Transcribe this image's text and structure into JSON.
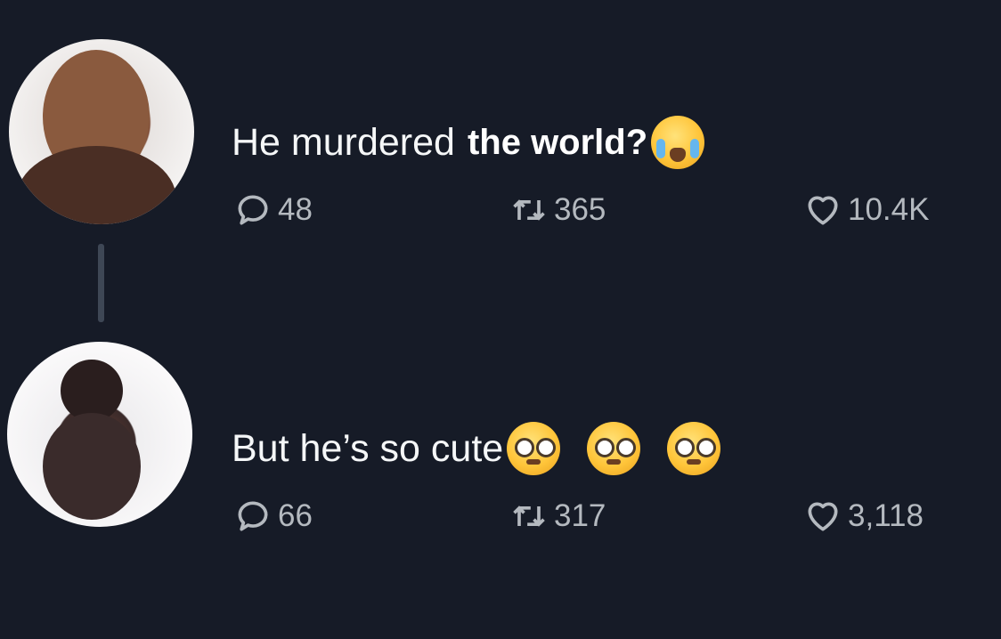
{
  "tweets": [
    {
      "text": "He murdered",
      "overlay_text": "the world?",
      "emoji": "loudly-crying-face",
      "stats": {
        "replies": "48",
        "retweets": "365",
        "likes": "10.4K"
      }
    },
    {
      "text": "But he’s so cute",
      "emoji": "pleading-face",
      "emoji_count": 3,
      "stats": {
        "replies": "66",
        "retweets": "317",
        "likes": "3,118"
      }
    }
  ],
  "colors": {
    "background": "#161b27",
    "text": "#f5f7f8",
    "meta": "#b4b9bf"
  }
}
